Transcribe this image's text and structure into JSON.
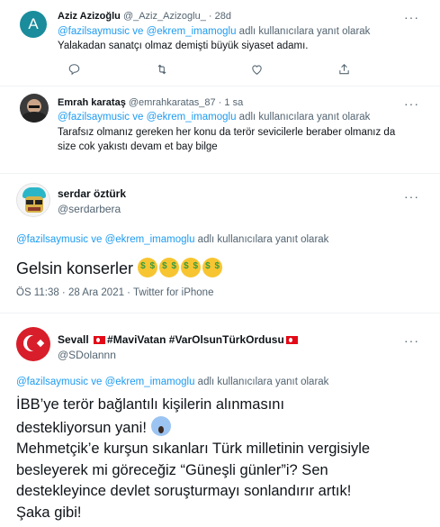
{
  "tweet1": {
    "avatar_letter": "A",
    "name": "Aziz Azizoğlu",
    "handle_time": "@_Aziz_Azizoglu_ · 28d",
    "reply_users": "@fazilsaymusic ve @ekrem_imamoglu",
    "reply_suffix": "adlı kullanıcılara yanıt olarak",
    "text": "Yalakadan sanatçı olmaz demişti büyük siyaset adamı."
  },
  "tweet2": {
    "name": "Emrah karataş",
    "handle_time": "@emrahkaratas_87 · 1 sa",
    "reply_users": "@fazilsaymusic ve @ekrem_imamoglu",
    "reply_suffix": "adlı kullanıcılara yanıt olarak",
    "text_line1": "Tarafsız olmanız gereken her konu da terör sevicilerle beraber olmanız da",
    "text_line2": "size cok yakıstı devam et bay bilge"
  },
  "tweet3": {
    "name": "serdar öztürk",
    "handle": "@serdarbera",
    "reply_users": "@fazilsaymusic ve @ekrem_imamoglu",
    "reply_suffix": "adlı kullanıcılara yanıt olarak",
    "text": "Gelsin konserler",
    "meta": "ÖS 11:38 · 28 Ara 2021 · Twitter for iPhone"
  },
  "tweet4": {
    "name_prefix": "Sevall",
    "name_part1": "#MaviVatan",
    "name_part2": "#VarOlsunTürkOrdusu",
    "handle": "@SDolannn",
    "reply_users": "@fazilsaymusic ve @ekrem_imamoglu",
    "reply_suffix": "adlı kullanıcılara yanıt olarak",
    "line1": "İBB’ye terör bağlantılı kişilerin alınmasını",
    "line2": "destekliyorsun yani!",
    "line3": "Mehmetçik’e kurşun sıkanları Türk milletinin vergisiyle",
    "line4": "besleyerek mi göreceğiz “Güneşli günler”i? Sen",
    "line5": "destekleyince devlet soruşturmayı sonlandırır artık!",
    "line6": "Şaka gibi!"
  },
  "colors": {
    "link_blue": "#1d9bf0",
    "text_gray": "#536471",
    "avatar_teal": "#1a8c9c",
    "flag_red": "#e30a17"
  }
}
